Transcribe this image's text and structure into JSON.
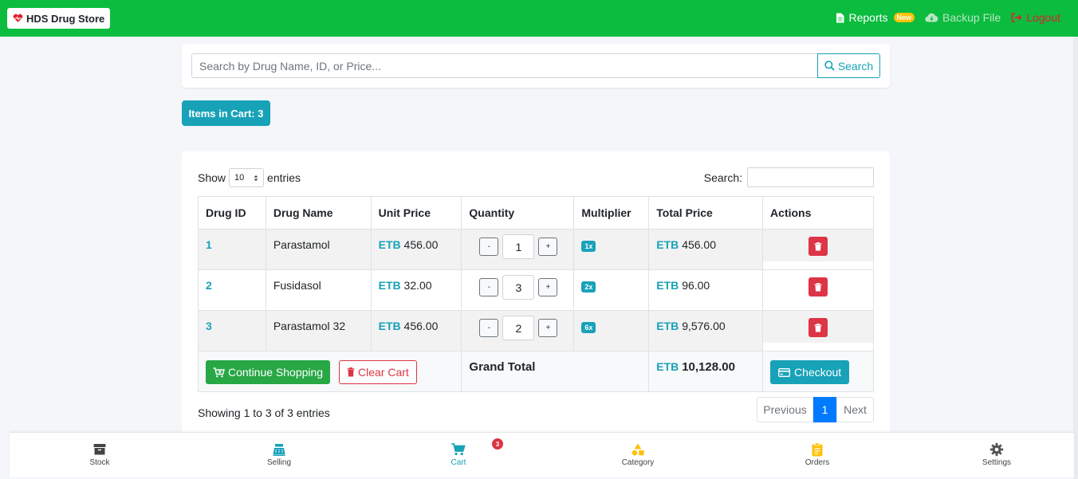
{
  "navbar": {
    "brand": "HDS Drug Store",
    "reports_label": "Reports",
    "reports_badge": "New",
    "backup_label": "Backup File",
    "logout_label": "Logout"
  },
  "search": {
    "placeholder": "Search by Drug Name, ID, or Price...",
    "button_label": "Search"
  },
  "cart_count_label": "Items in Cart: 3",
  "table_controls": {
    "show_label": "Show",
    "entries_value": "10",
    "entries_label": "entries",
    "search_label": "Search:"
  },
  "table": {
    "headers": [
      "Drug ID",
      "Drug Name",
      "Unit Price",
      "Quantity",
      "Multiplier",
      "Total Price",
      "Actions"
    ],
    "currency": "ETB",
    "rows": [
      {
        "id": "1",
        "name": "Parastamol",
        "unit_price": "456.00",
        "quantity": "1",
        "multiplier": "1x",
        "total": "456.00"
      },
      {
        "id": "2",
        "name": "Fusidasol",
        "unit_price": "32.00",
        "quantity": "3",
        "multiplier": "2x",
        "total": "96.00"
      },
      {
        "id": "3",
        "name": "Parastamol 32",
        "unit_price": "456.00",
        "quantity": "2",
        "multiplier": "6x",
        "total": "9,576.00"
      }
    ],
    "qty_minus": "-",
    "qty_plus": "+",
    "footer": {
      "continue_label": "Continue Shopping",
      "clear_label": "Clear Cart",
      "grand_total_label": "Grand Total",
      "grand_total_value": "10,128.00",
      "checkout_label": "Checkout"
    }
  },
  "info_text": "Showing 1 to 3 of 3 entries",
  "pagination": {
    "previous": "Previous",
    "current": "1",
    "next": "Next"
  },
  "bottom_nav": {
    "items": [
      {
        "label": "Stock",
        "icon": "archive-icon"
      },
      {
        "label": "Selling",
        "icon": "cash-register-icon"
      },
      {
        "label": "Cart",
        "icon": "cart-icon"
      },
      {
        "label": "Category",
        "icon": "shapes-icon"
      },
      {
        "label": "Orders",
        "icon": "clipboard-icon"
      },
      {
        "label": "Settings",
        "icon": "gear-icon"
      }
    ],
    "cart_badge": "3"
  },
  "colors": {
    "navbar": "#0cbc3f",
    "accent": "#17a2b8",
    "danger": "#dc3545",
    "success": "#28a745",
    "primary": "#007bff",
    "warning": "#ffc107"
  }
}
